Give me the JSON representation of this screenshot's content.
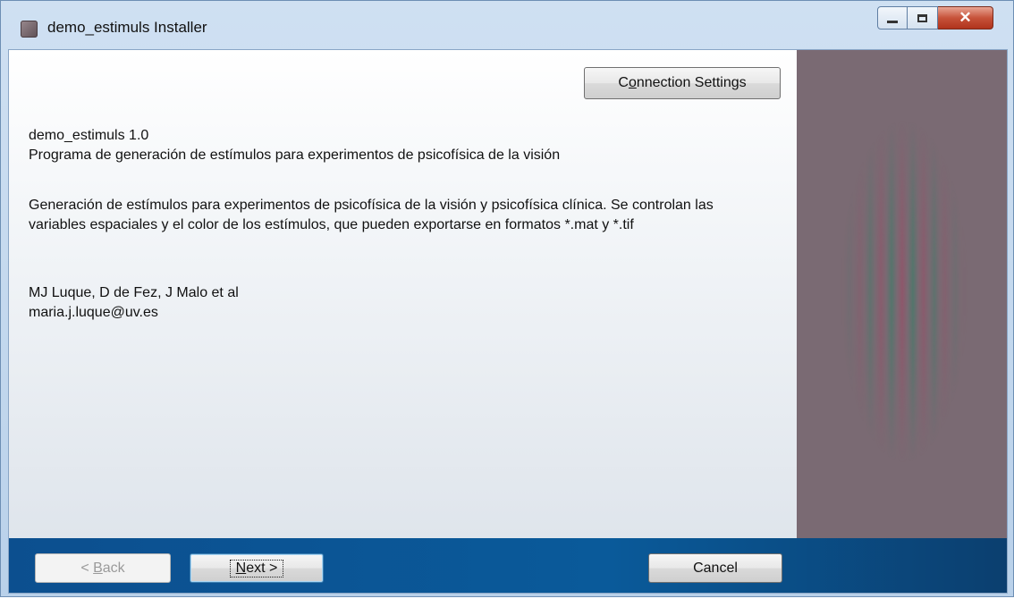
{
  "window": {
    "title": "demo_estimuls Installer",
    "controls": {
      "minimize": "minimize",
      "maximize": "maximize",
      "close": "✕"
    }
  },
  "toolbar": {
    "connection_settings": {
      "prefix": "C",
      "mnemonic": "o",
      "suffix": "nnection Settings"
    }
  },
  "content": {
    "product": "demo_estimuls 1.0",
    "subtitle": "Programa de generación de estímulos para experimentos de psicofísica de la visión",
    "description": "Generación de estímulos para experimentos de psicofísica de la visión y psicofísica clínica. Se controlan las variables espaciales y el color de los estímulos, que pueden exportarse en formatos *.mat y *.tif",
    "authors": "MJ Luque, D de Fez, J Malo et al",
    "email": "maria.j.luque@uv.es"
  },
  "footer": {
    "back": {
      "prefix": "< ",
      "mnemonic": "B",
      "suffix": "ack",
      "enabled": false
    },
    "next": {
      "prefix": "",
      "mnemonic": "N",
      "suffix": "ext >",
      "enabled": true,
      "focused": true
    },
    "cancel": {
      "label": "Cancel",
      "enabled": true
    }
  },
  "colors": {
    "side_panel": "#7a6a73",
    "footer_bar": "#0a5a9a"
  }
}
